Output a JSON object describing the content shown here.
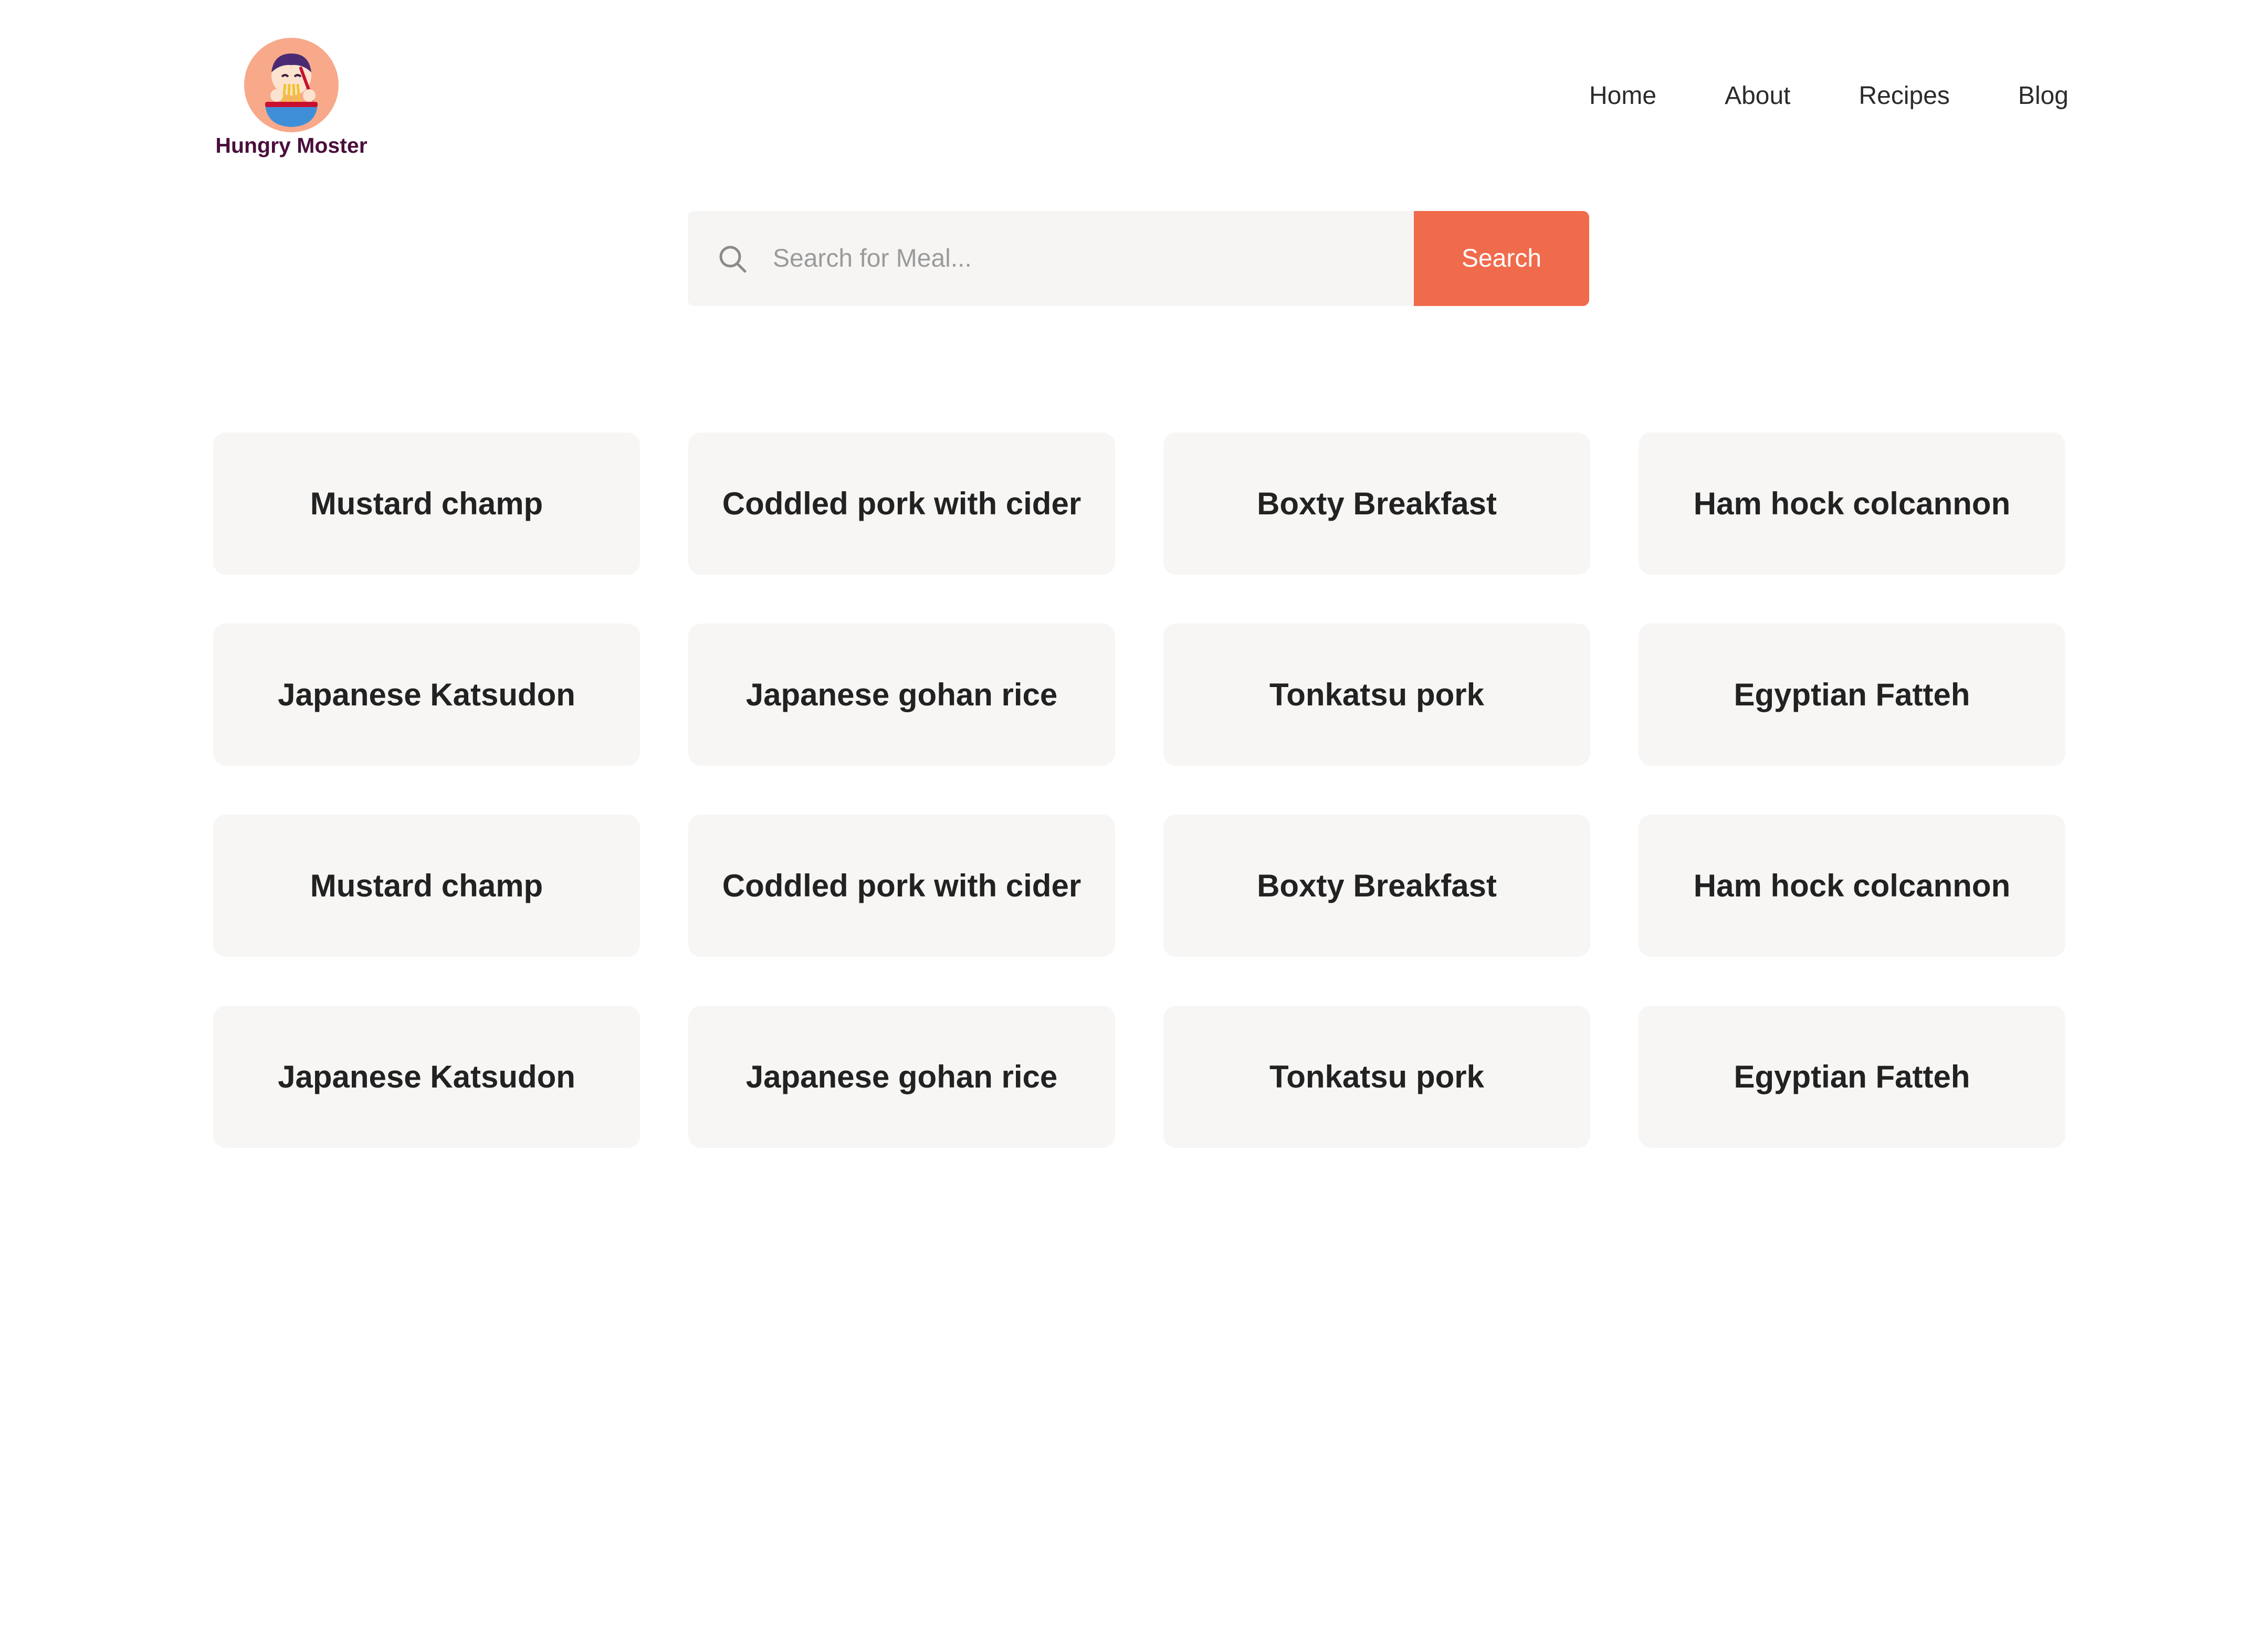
{
  "brand": {
    "name": "Hungry Moster",
    "logo_icon": "noodle-eating-mascot-icon",
    "colors": {
      "logo_circle": "#f7a98a",
      "logo_text": "#4a0f3c"
    }
  },
  "nav": {
    "items": [
      {
        "label": "Home"
      },
      {
        "label": "About"
      },
      {
        "label": "Recipes"
      },
      {
        "label": "Blog"
      }
    ]
  },
  "search": {
    "placeholder": "Search for Meal...",
    "value": "",
    "button_label": "Search",
    "icon": "search-icon",
    "colors": {
      "field_bg": "#f6f5f4",
      "button_bg": "#f06b4c",
      "button_text": "#ffffff"
    }
  },
  "meals": [
    {
      "name": "Mustard champ"
    },
    {
      "name": "Coddled pork with cider"
    },
    {
      "name": "Boxty Breakfast"
    },
    {
      "name": "Ham hock colcannon"
    },
    {
      "name": "Japanese Katsudon"
    },
    {
      "name": "Japanese gohan rice"
    },
    {
      "name": "Tonkatsu pork"
    },
    {
      "name": "Egyptian Fatteh"
    },
    {
      "name": "Mustard champ"
    },
    {
      "name": "Coddled pork with cider"
    },
    {
      "name": "Boxty Breakfast"
    },
    {
      "name": "Ham hock colcannon"
    },
    {
      "name": "Japanese Katsudon"
    },
    {
      "name": "Japanese gohan rice"
    },
    {
      "name": "Tonkatsu pork"
    },
    {
      "name": "Egyptian Fatteh"
    }
  ],
  "card_color": "#f7f6f4"
}
